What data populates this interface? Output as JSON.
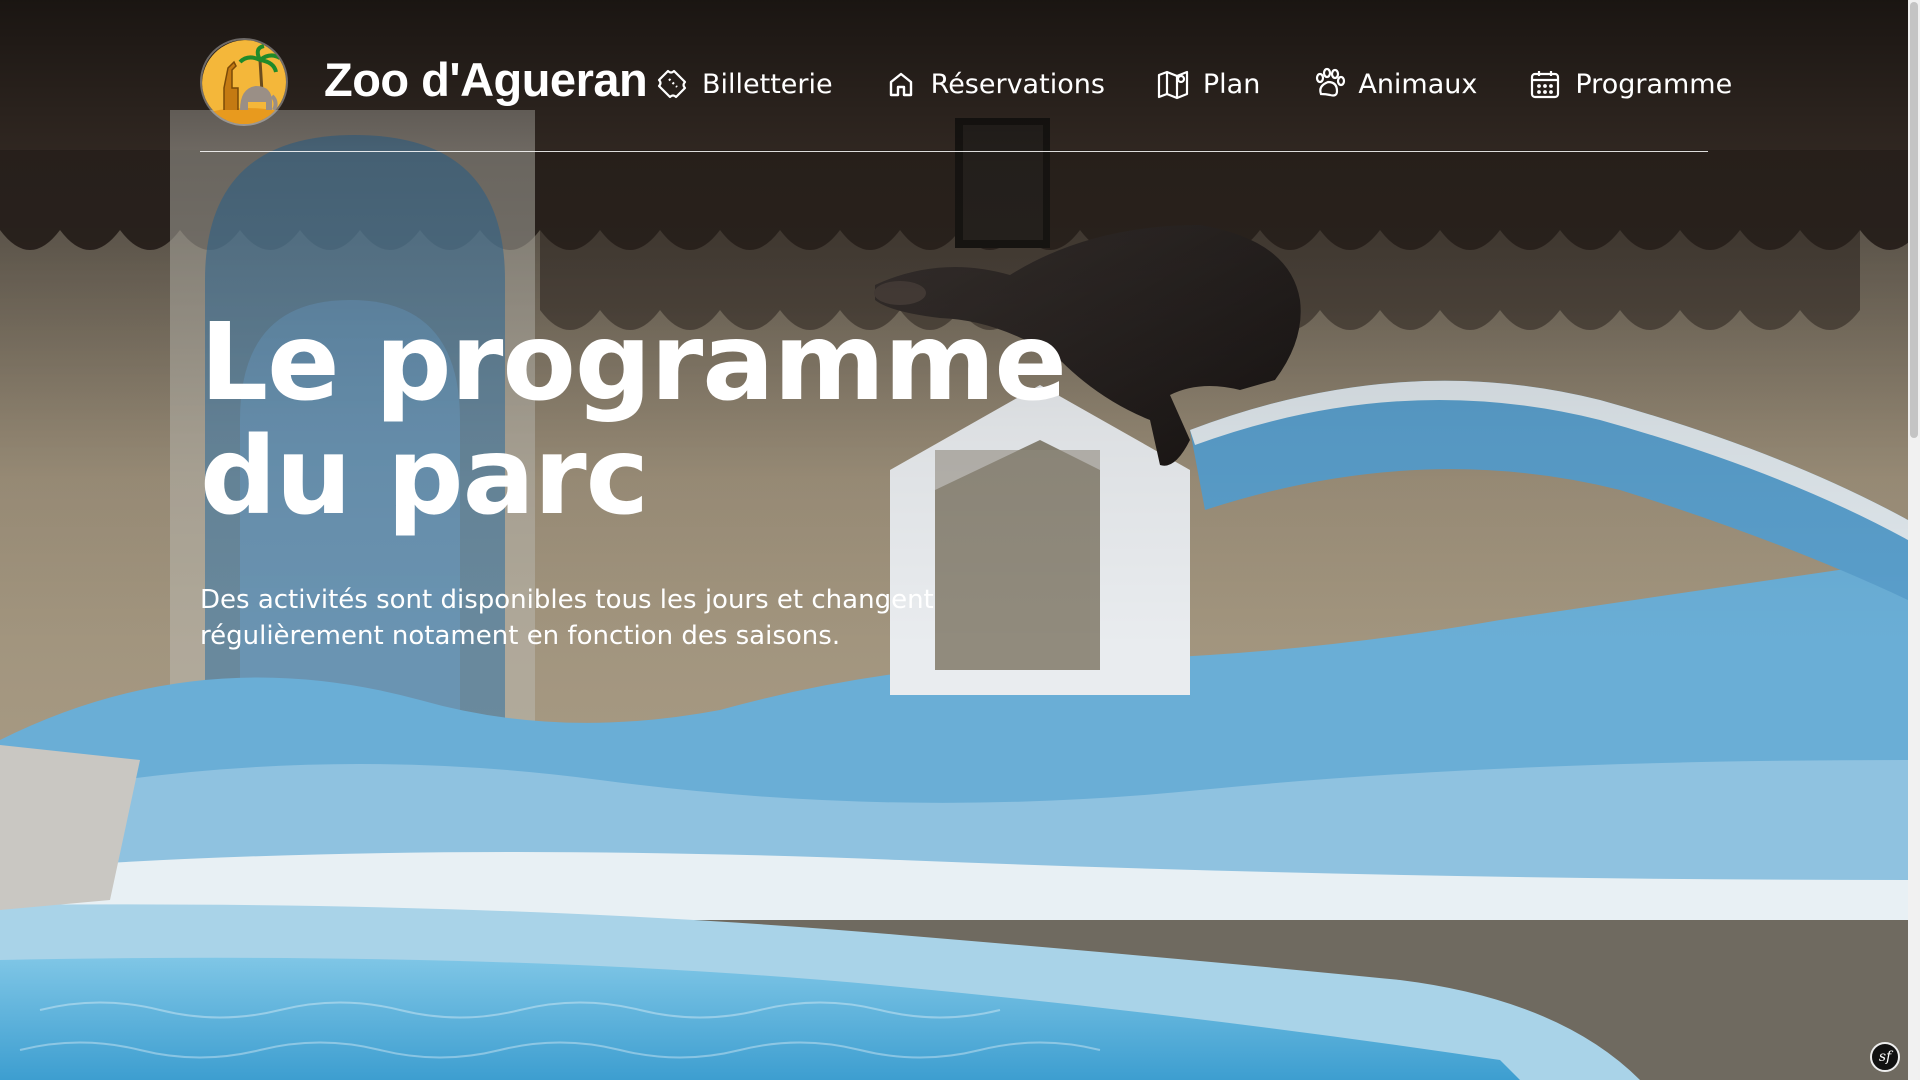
{
  "header": {
    "brand": "Zoo d'Agueran",
    "logo_icon": "giraffe-elephant-palm-logo",
    "nav": [
      {
        "label": "Billetterie",
        "icon": "ticket-icon"
      },
      {
        "label": "Réservations",
        "icon": "home-icon"
      },
      {
        "label": "Plan",
        "icon": "map-icon"
      },
      {
        "label": "Animaux",
        "icon": "paw-icon"
      },
      {
        "label": "Programme",
        "icon": "calendar-icon"
      }
    ]
  },
  "hero": {
    "title_line1": "Le programme",
    "title_line2": "du parc",
    "subtitle": "Des activités sont disponibles tous les jours et changent régulièrement notament en fonction des saisons.",
    "background": "sea-lion-pool-photo"
  },
  "footer_badge": {
    "icon": "symfony-icon"
  },
  "colors": {
    "text": "#ffffff",
    "pool": "#6aaed6",
    "wall": "#a89c86"
  }
}
